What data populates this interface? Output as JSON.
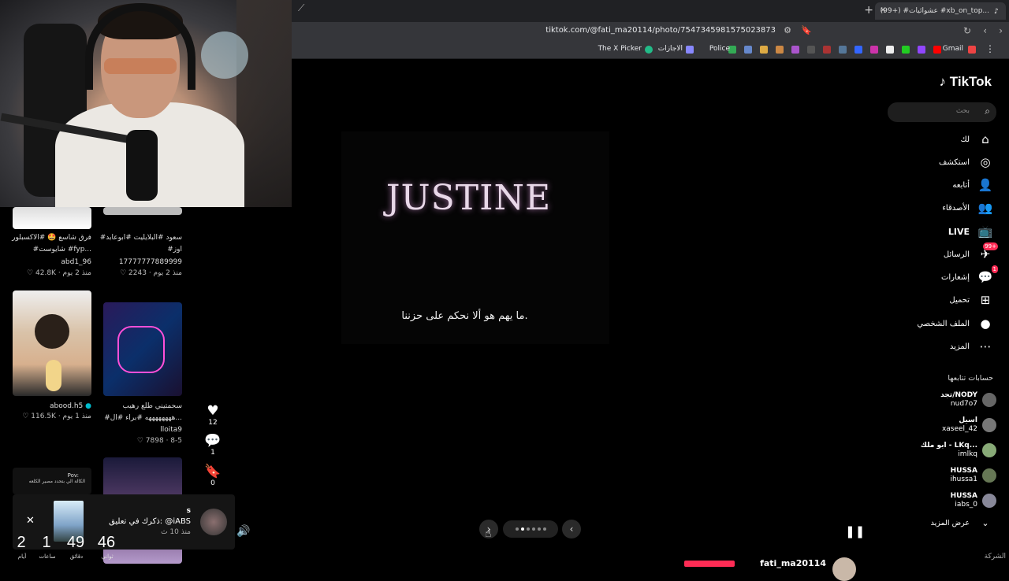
{
  "browser": {
    "tab_title": "(99+) #عشوائيات #xb_on_top...",
    "url": "tiktok.com/@fati_ma20114/photo/7547345981575023873",
    "bookmarks": [
      "The X Picker",
      "الاجازات",
      "Police",
      "Gmail"
    ]
  },
  "grid": {
    "items": [
      {
        "caption": "فرق شاسع 🤩 #الاكسبلور",
        "caption2": "#شايوست #fyp...",
        "user": "abd1_96",
        "likes": "42.8K",
        "age": "منذ 2 يوم"
      },
      {
        "caption": "#سعود #البلايليت #ابوعابد",
        "caption2": "#اوز",
        "user": "17777777889999",
        "likes": "2243",
        "age": "منذ 2 يوم"
      },
      {
        "caption": "",
        "caption2": "",
        "user": "abood.h5",
        "likes": "116.5K",
        "age": "منذ 1 يوم"
      },
      {
        "caption": "سحمتيني طلع رهيب",
        "caption2": "#ههههههههه #براء #ال...",
        "user": "lloita9",
        "likes": "7898",
        "age": "8-5"
      }
    ],
    "pov_caption": "Pov:",
    "pov_caption2": "الكالة الي بتحدد مصير الكلعه"
  },
  "actions": {
    "likes": "12",
    "comments": "1",
    "saves": "0"
  },
  "photo": {
    "title": "JUSTINE",
    "subtitle": "ما يهم هو ألا نحكم على حزننا."
  },
  "nav": {
    "logo": "TikTok",
    "search_placeholder": "بحث",
    "items": [
      {
        "label": "لك",
        "icon": "home-icon"
      },
      {
        "label": "استكشف",
        "icon": "compass-icon"
      },
      {
        "label": "أتابعه",
        "icon": "user-follow-icon"
      },
      {
        "label": "الأصدقاء",
        "icon": "friends-icon"
      },
      {
        "label": "LIVE",
        "icon": "live-icon"
      },
      {
        "label": "الرسائل",
        "icon": "messages-icon",
        "badge": "99+"
      },
      {
        "label": "إشعارات",
        "icon": "inbox-icon",
        "badge": "1"
      },
      {
        "label": "تحميل",
        "icon": "upload-icon"
      },
      {
        "label": "الملف الشخصي",
        "icon": "profile-icon"
      },
      {
        "label": "المزيد",
        "icon": "more-icon"
      }
    ],
    "following_title": "حسابات تتابعها",
    "following": [
      {
        "name": "تجد/NODY",
        "handle": "nud7o7"
      },
      {
        "name": "اسيل",
        "handle": "xaseel_42"
      },
      {
        "name": "ابو ملك - LKq...",
        "handle": "imlkq"
      },
      {
        "name": "HUSSA",
        "handle": "ihussa1"
      },
      {
        "name": "HUSSA",
        "handle": "iabs_0"
      }
    ],
    "see_more": "عرض المزيد",
    "company": "الشركة"
  },
  "notification": {
    "user": "s",
    "text": "ذكرك في تعليق: @iABS",
    "time": "منذ 10 ث"
  },
  "timer": [
    {
      "value": "2",
      "label": "أيام"
    },
    {
      "value": "1",
      "label": "ساعات"
    },
    {
      "value": "49",
      "label": "دقائق"
    },
    {
      "value": "46",
      "label": "ثواني"
    }
  ],
  "bottom_user": "fati_ma20114"
}
